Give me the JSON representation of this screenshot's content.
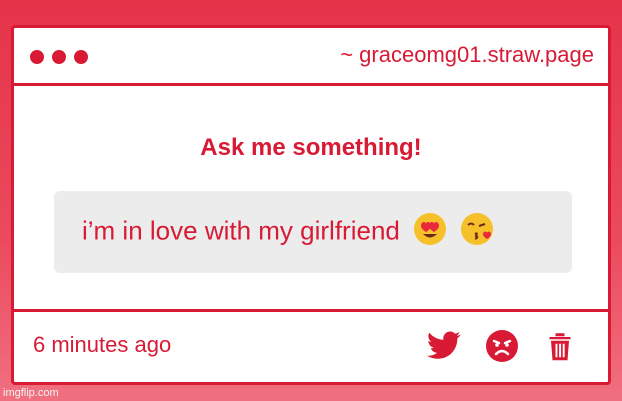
{
  "window": {
    "url": "~ graceomg01.straw.page"
  },
  "question": {
    "prompt": "Ask me something!",
    "answer_text": "i’m in love with my girlfriend",
    "emojis": [
      "heart-eyes-emoji",
      "kissing-heart-emoji"
    ]
  },
  "footer": {
    "timestamp": "6 minutes ago",
    "actions": [
      "twitter-share",
      "report",
      "delete"
    ]
  },
  "watermark": "imgflip.com",
  "colors": {
    "accent": "#d81a34",
    "background": "#e5334a",
    "answer_bg": "#ececec"
  }
}
